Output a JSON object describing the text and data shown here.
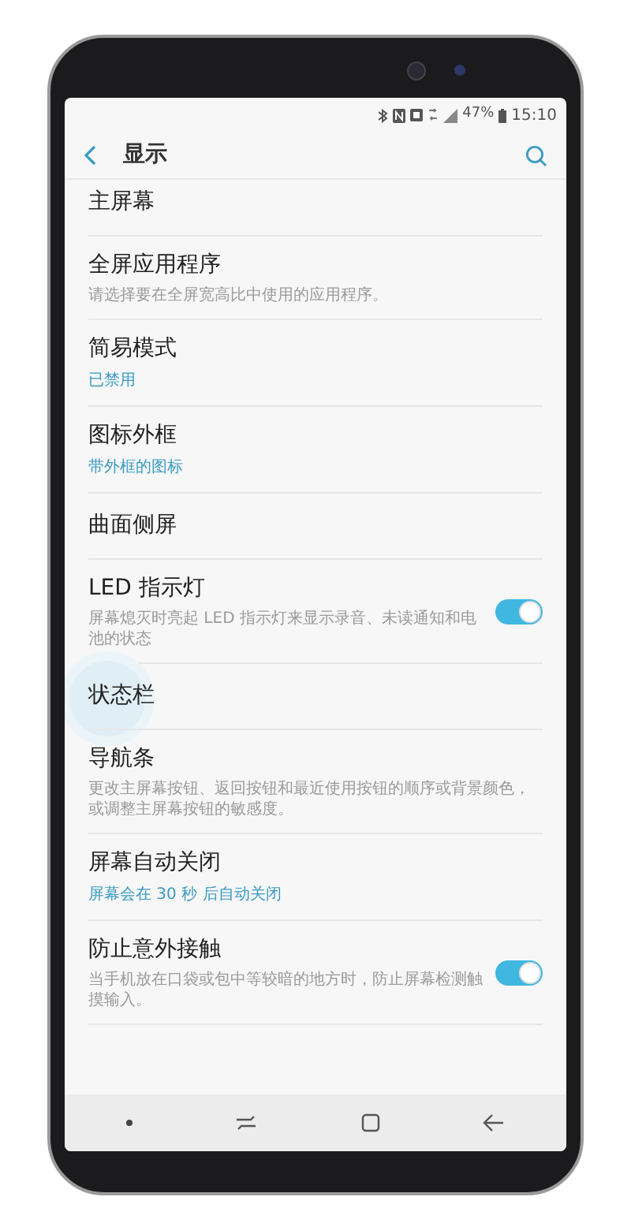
{
  "status_bar": {
    "battery_percent": "47%",
    "time": "15:10"
  },
  "header": {
    "title": "显示"
  },
  "settings": [
    {
      "title": "主屏幕"
    },
    {
      "title": "全屏应用程序",
      "description": "请选择要在全屏宽高比中使用的应用程序。"
    },
    {
      "title": "简易模式",
      "value": "已禁用"
    },
    {
      "title": "图标外框",
      "value": "带外框的图标"
    },
    {
      "title": "曲面侧屏"
    },
    {
      "title": "LED 指示灯",
      "description": "屏幕熄灭时亮起 LED 指示灯来显示录音、未读通知和电池的状态",
      "toggle": {
        "on": true
      }
    },
    {
      "title": "状态栏",
      "pressed": true
    },
    {
      "title": "导航条",
      "description": "更改主屏幕按钮、返回按钮和最近使用按钮的顺序或背景颜色，或调整主屏幕按钮的敏感度。"
    },
    {
      "title": "屏幕自动关闭",
      "value": "屏幕会在 30 秒 后自动关闭"
    },
    {
      "title": "防止意外接触",
      "description": "当手机放在口袋或包中等较暗的地方时，防止屏幕检测触摸输入。",
      "toggle": {
        "on": true
      }
    }
  ]
}
